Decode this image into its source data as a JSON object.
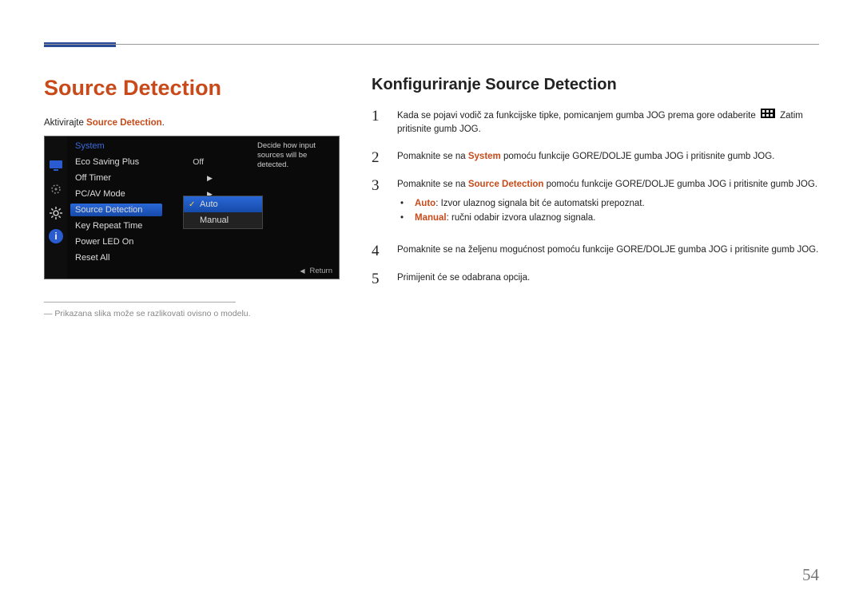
{
  "page_number": "54",
  "left": {
    "title": "Source Detection",
    "intro_prefix": "Aktivirajte ",
    "intro_hl": "Source Detection",
    "intro_suffix": ".",
    "osd": {
      "header": "System",
      "tooltip": "Decide how input sources will be detected.",
      "items": [
        {
          "label": "Eco Saving Plus",
          "value": "Off",
          "chev": ""
        },
        {
          "label": "Off Timer",
          "value": "",
          "chev": "▶"
        },
        {
          "label": "PC/AV Mode",
          "value": "",
          "chev": "▶"
        },
        {
          "label": "Source Detection",
          "value": "",
          "chev": "",
          "selected": true
        },
        {
          "label": "Key Repeat Time",
          "value": "",
          "chev": ""
        },
        {
          "label": "Power LED On",
          "value": "",
          "chev": ""
        },
        {
          "label": "Reset All",
          "value": "",
          "chev": ""
        }
      ],
      "submenu": [
        {
          "label": "Auto",
          "active": true,
          "checked": true
        },
        {
          "label": "Manual",
          "active": false,
          "checked": false
        }
      ],
      "footer_return": "Return"
    },
    "footnote": "Prikazana slika može se razlikovati ovisno o modelu."
  },
  "right": {
    "title": "Konfiguriranje Source Detection",
    "steps": {
      "s1_a": "Kada se pojavi vodič za funkcijske tipke, pomicanjem gumba JOG prema gore odaberite ",
      "s1_b": " Zatim pritisnite gumb JOG.",
      "s2_a": "Pomaknite se na ",
      "s2_hl": "System",
      "s2_b": " pomoću funkcije GORE/DOLJE gumba JOG i pritisnite gumb JOG.",
      "s3_a": "Pomaknite se na ",
      "s3_hl": "Source Detection",
      "s3_b": " pomoću funkcije GORE/DOLJE gumba JOG i pritisnite gumb JOG.",
      "bullet1_hl": "Auto",
      "bullet1_txt": ": Izvor ulaznog signala bit će automatski prepoznat.",
      "bullet2_hl": "Manual",
      "bullet2_txt": ": ručni odabir izvora ulaznog signala.",
      "s4": "Pomaknite se na željenu mogućnost pomoću funkcije GORE/DOLJE gumba JOG i pritisnite gumb JOG.",
      "s5": "Primijenit će se odabrana opcija."
    }
  }
}
